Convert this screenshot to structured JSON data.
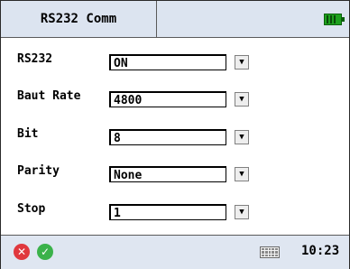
{
  "window": {
    "title": "RS232 Comm",
    "battery_icon": "battery-full-icon"
  },
  "form": {
    "rows": [
      {
        "label": "RS232",
        "value": "ON"
      },
      {
        "label": "Baut Rate",
        "value": "4800"
      },
      {
        "label": "Bit",
        "value": "8"
      },
      {
        "label": "Parity",
        "value": "None"
      },
      {
        "label": "Stop",
        "value": "1"
      }
    ],
    "dropdown_icon": "chevron-down-icon"
  },
  "taskbar": {
    "cancel_icon": "cancel-icon",
    "ok_icon": "ok-icon",
    "keyboard_icon": "keyboard-icon",
    "time": "10:23"
  },
  "colors": {
    "titlebar_bg": "#dce4f0",
    "taskbar_bg": "#dfe6f1",
    "cancel": "#e0383e",
    "ok": "#3bb24a",
    "battery": "#1ea11e"
  }
}
